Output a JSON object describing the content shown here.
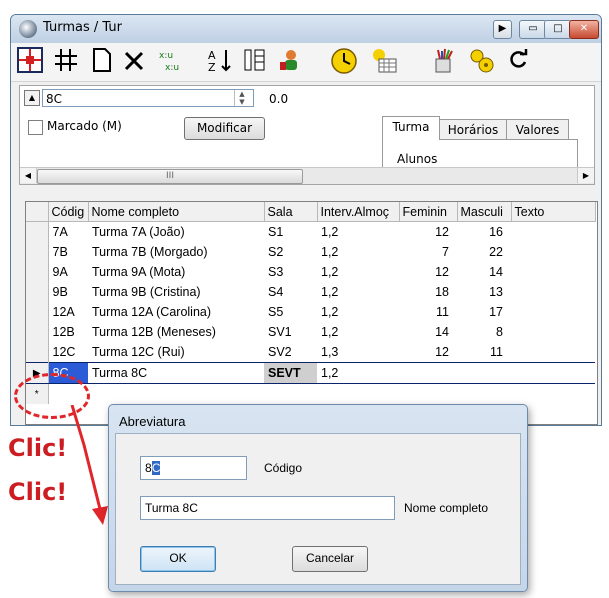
{
  "window": {
    "title": "Turmas / Tur",
    "controls": {
      "system": "▶",
      "minimize": "▭",
      "maximize": "□",
      "close": "✕"
    }
  },
  "toolbar": {
    "icons": [
      "grid-select-icon",
      "hash-icon",
      "new-document-icon",
      "delete-icon",
      "sort-columns-icon",
      "sort-az-icon",
      "columns-icon",
      "person-icon",
      "clock-icon",
      "calendar-icon",
      "paint-icon",
      "settings-icon",
      "refresh-icon"
    ]
  },
  "form": {
    "code_value": "8C",
    "number_value": "0.0",
    "marcado_label": "Marcado (M)",
    "modificar_label": "Modificar",
    "tabs": [
      "Turma",
      "Horários",
      "Valores"
    ],
    "alunos_label": "Alunos",
    "scroll_thumb_label": "III"
  },
  "grid": {
    "columns": [
      "Códig",
      "Nome completo",
      "Sala",
      "Interv.Almoç",
      "Feminin",
      "Masculi",
      "Texto"
    ],
    "rows": [
      {
        "code": "7A",
        "name": "Turma 7A (João)",
        "sala": "S1",
        "interv": "1,2",
        "fem": "12",
        "masc": "16",
        "texto": ""
      },
      {
        "code": "7B",
        "name": "Turma 7B (Morgado)",
        "sala": "S2",
        "interv": "1,2",
        "fem": "7",
        "masc": "22",
        "texto": ""
      },
      {
        "code": "9A",
        "name": "Turma 9A (Mota)",
        "sala": "S3",
        "interv": "1,2",
        "fem": "12",
        "masc": "14",
        "texto": ""
      },
      {
        "code": "9B",
        "name": "Turma 9B (Cristina)",
        "sala": "S4",
        "interv": "1,2",
        "fem": "18",
        "masc": "13",
        "texto": ""
      },
      {
        "code": "12A",
        "name": "Turma 12A (Carolina)",
        "sala": "S5",
        "interv": "1,2",
        "fem": "11",
        "masc": "17",
        "texto": ""
      },
      {
        "code": "12B",
        "name": "Turma 12B (Meneses)",
        "sala": "SV1",
        "interv": "1,2",
        "fem": "14",
        "masc": "8",
        "texto": ""
      },
      {
        "code": "12C",
        "name": "Turma 12C (Rui)",
        "sala": "SV2",
        "interv": "1,3",
        "fem": "12",
        "masc": "11",
        "texto": ""
      },
      {
        "code": "8C",
        "name": "Turma 8C",
        "sala": "SEVT",
        "interv": "1,2",
        "fem": "",
        "masc": "",
        "texto": "",
        "selected": true
      }
    ],
    "current_row_marker": "▶",
    "new_row_marker": "*"
  },
  "annotation": {
    "clic_1": "Clic!",
    "clic_2": "Clic!",
    "color": "#cc1e22"
  },
  "dialog": {
    "title": "Abreviatura",
    "code_value_prefix": "8",
    "code_value_selected": "C",
    "code_label": "Código",
    "name_value": "Turma 8C",
    "name_label": "Nome completo",
    "ok_label": "OK",
    "cancel_label": "Cancelar"
  }
}
